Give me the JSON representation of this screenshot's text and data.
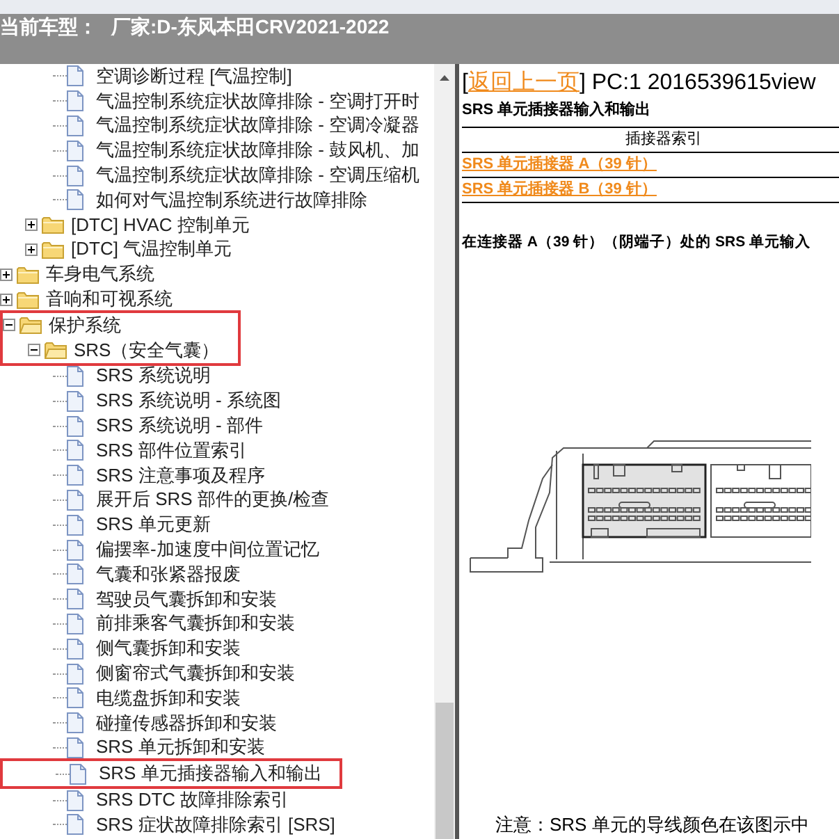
{
  "header": {
    "label": "当前车型：",
    "model": "厂家:D-东风本田CRV2021-2022"
  },
  "tree": [
    {
      "kind": "hidden",
      "children": [
        {
          "kind": "hidden",
          "children": [
            {
              "kind": "file",
              "label": "空调诊断过程 [气温控制]",
              "boxed": false
            },
            {
              "kind": "file",
              "label": "气温控制系统症状故障排除 - 空调打开时",
              "boxed": false
            },
            {
              "kind": "file",
              "label": "气温控制系统症状故障排除 - 空调冷凝器",
              "boxed": false
            },
            {
              "kind": "file",
              "label": "气温控制系统症状故障排除 - 鼓风机、加",
              "boxed": false
            },
            {
              "kind": "file",
              "label": "气温控制系统症状故障排除 - 空调压缩机",
              "boxed": false
            },
            {
              "kind": "file",
              "label": "如何对气温控制系统进行故障排除",
              "boxed": false
            }
          ]
        },
        {
          "kind": "folder",
          "label": "[DTC] HVAC 控制单元",
          "expanded": false,
          "boxed": false
        },
        {
          "kind": "folder",
          "label": "[DTC] 气温控制单元",
          "expanded": false,
          "boxed": false
        }
      ]
    },
    {
      "kind": "folder",
      "label": "车身电气系统",
      "expanded": false,
      "boxed": false
    },
    {
      "kind": "folder",
      "label": "音响和可视系统",
      "expanded": false,
      "boxed": false
    },
    {
      "kind": "folder",
      "label": "保护系统",
      "expanded": true,
      "boxed": true,
      "children": [
        {
          "kind": "folder",
          "label": "SRS（安全气囊）",
          "expanded": true,
          "boxed": true,
          "children": [
            {
              "kind": "file",
              "label": "SRS 系统说明",
              "boxed": false
            },
            {
              "kind": "file",
              "label": "SRS 系统说明 - 系统图",
              "boxed": false
            },
            {
              "kind": "file",
              "label": "SRS 系统说明 - 部件",
              "boxed": false
            },
            {
              "kind": "file",
              "label": "SRS 部件位置索引",
              "boxed": false
            },
            {
              "kind": "file",
              "label": "SRS 注意事项及程序",
              "boxed": false
            },
            {
              "kind": "file",
              "label": "展开后 SRS 部件的更换/检查",
              "boxed": false
            },
            {
              "kind": "file",
              "label": "SRS 单元更新",
              "boxed": false
            },
            {
              "kind": "file",
              "label": "偏摆率-加速度中间位置记忆",
              "boxed": false
            },
            {
              "kind": "file",
              "label": "气囊和张紧器报废",
              "boxed": false
            },
            {
              "kind": "file",
              "label": "驾驶员气囊拆卸和安装",
              "boxed": false
            },
            {
              "kind": "file",
              "label": "前排乘客气囊拆卸和安装",
              "boxed": false
            },
            {
              "kind": "file",
              "label": "侧气囊拆卸和安装",
              "boxed": false
            },
            {
              "kind": "file",
              "label": "侧窗帘式气囊拆卸和安装",
              "boxed": false
            },
            {
              "kind": "file",
              "label": "电缆盘拆卸和安装",
              "boxed": false
            },
            {
              "kind": "file",
              "label": "碰撞传感器拆卸和安装",
              "boxed": false
            },
            {
              "kind": "file",
              "label": "SRS 单元拆卸和安装",
              "boxed": false
            },
            {
              "kind": "file",
              "label": "SRS 单元插接器输入和输出",
              "boxed": true
            },
            {
              "kind": "file",
              "label": "SRS DTC 故障排除索引",
              "boxed": false
            },
            {
              "kind": "file",
              "label": "SRS 症状故障排除索引 [SRS]",
              "boxed": false
            }
          ]
        }
      ]
    }
  ],
  "content": {
    "bracket_open": "[",
    "back_link": "返回上一页",
    "page_id": "] PC:1 2016539615view",
    "title": "SRS 单元插接器输入和输出",
    "index_table": {
      "heading": "插接器索引",
      "links": [
        "SRS 单元插接器 A（39 针）",
        "SRS 单元插接器 B（39 针）"
      ]
    },
    "section_heading": "在连接器 A（39 针）（阴端子）处的 SRS 单元输入",
    "note": "注意：SRS 单元的导线颜色在该图示中"
  }
}
